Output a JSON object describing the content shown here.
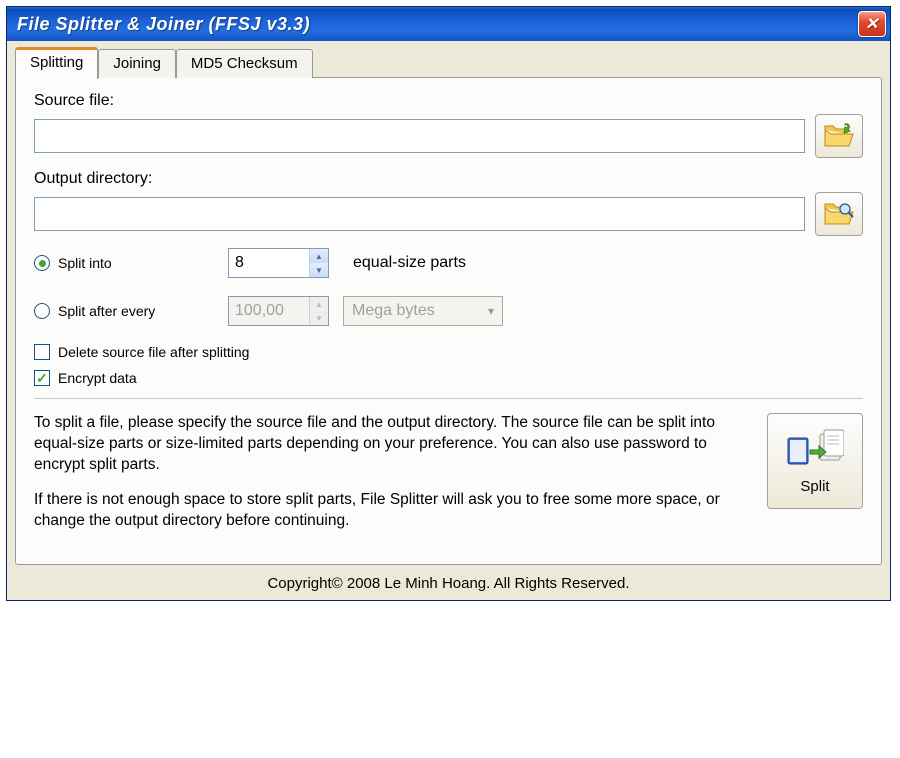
{
  "window": {
    "title": "File Splitter & Joiner (FFSJ v3.3)"
  },
  "tabs": {
    "splitting": "Splitting",
    "joining": "Joining",
    "md5": "MD5 Checksum"
  },
  "labels": {
    "source_file": "Source file:",
    "output_dir": "Output directory:",
    "split_into": "Split into",
    "equal_parts": "equal-size parts",
    "split_after": "Split after every",
    "delete_source": "Delete source file after splitting",
    "encrypt": "Encrypt data"
  },
  "inputs": {
    "source_file": "",
    "output_dir": "",
    "parts_count": "8",
    "size_value": "100,00",
    "size_unit": "Mega bytes"
  },
  "help": {
    "p1": "To split a file, please specify the source file and the output directory. The source file can be split into equal-size parts or size-limited parts depending on your preference. You can also use password to encrypt split parts.",
    "p2": "If there is not enough space to store split parts, File Splitter will ask you to free some more space, or change the output directory before continuing."
  },
  "buttons": {
    "split": "Split"
  },
  "footer": "Copyright© 2008 Le Minh Hoang. All Rights Reserved."
}
